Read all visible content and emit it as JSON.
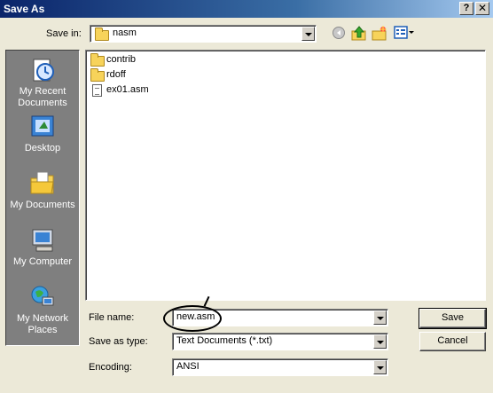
{
  "window": {
    "title": "Save As",
    "help_label": "?",
    "close_label": "✕"
  },
  "save_in": {
    "label": "Save in:",
    "value": "nasm"
  },
  "toolbar": {
    "icons": [
      "back-icon",
      "up-folder-icon",
      "new-folder-icon",
      "views-menu-icon"
    ]
  },
  "places": [
    {
      "label": "My Recent Documents",
      "icon": "recent-documents-icon"
    },
    {
      "label": "Desktop",
      "icon": "desktop-icon"
    },
    {
      "label": "My Documents",
      "icon": "my-documents-icon"
    },
    {
      "label": "My Computer",
      "icon": "my-computer-icon"
    },
    {
      "label": "My Network Places",
      "icon": "network-places-icon"
    }
  ],
  "files": [
    {
      "name": "contrib",
      "type": "folder"
    },
    {
      "name": "rdoff",
      "type": "folder"
    },
    {
      "name": "ex01.asm",
      "type": "file"
    }
  ],
  "form": {
    "file_name_label": "File name:",
    "file_name_value": "new.asm",
    "save_as_type_label": "Save as type:",
    "save_as_type_value": "Text Documents (*.txt)",
    "encoding_label": "Encoding:",
    "encoding_value": "ANSI"
  },
  "buttons": {
    "save": "Save",
    "cancel": "Cancel"
  },
  "colors": {
    "title_bar": "#0a246a",
    "places_bar": "#7f7f7f",
    "dialog_bg": "#ece9d8"
  }
}
